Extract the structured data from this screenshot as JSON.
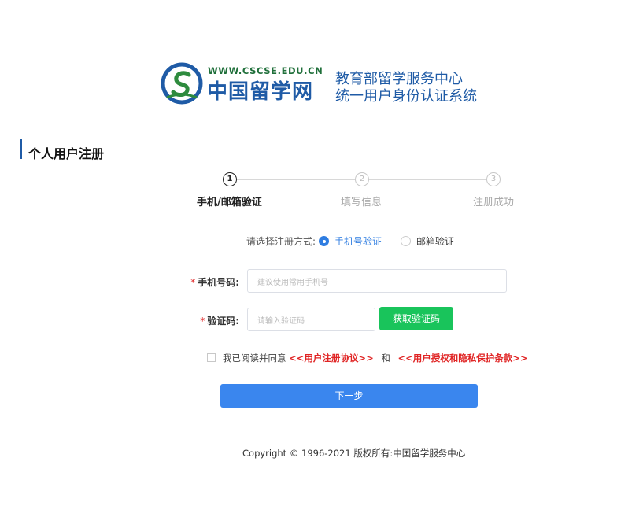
{
  "header": {
    "logo_url": "WWW.CSCSE.EDU.CN",
    "logo_cn": "中国留学网",
    "org_line1": "教育部留学服务中心",
    "org_line2": "统一用户身份认证系统"
  },
  "section": {
    "title": "个人用户注册"
  },
  "steps": [
    {
      "number": "1",
      "label": "手机/邮箱验证",
      "active": true
    },
    {
      "number": "2",
      "label": "填写信息",
      "active": false
    },
    {
      "number": "3",
      "label": "注册成功",
      "active": false
    }
  ],
  "method": {
    "prompt": "请选择注册方式:",
    "options": [
      {
        "label": "手机号验证",
        "selected": true
      },
      {
        "label": "邮箱验证",
        "selected": false
      }
    ]
  },
  "form": {
    "phone": {
      "label": "手机号码:",
      "value": "",
      "placeholder": "建议使用常用手机号"
    },
    "code": {
      "label": "验证码:",
      "value": "",
      "placeholder": "请输入验证码"
    },
    "get_code_button": "获取验证码",
    "required_mark": "*"
  },
  "agreement": {
    "text": "我已阅读并同意",
    "link1": "<<用户注册协议>>",
    "and": "和",
    "link2": "<<用户授权和隐私保护条款>>",
    "checked": false
  },
  "next_button": "下一步",
  "footer": "Copyright © 1996-2021 版权所有:中国留学服务中心",
  "colors": {
    "brand_blue": "#1f5ba6",
    "primary_button": "#3a86ee",
    "code_button": "#19c45b",
    "link_red": "#e02424"
  }
}
